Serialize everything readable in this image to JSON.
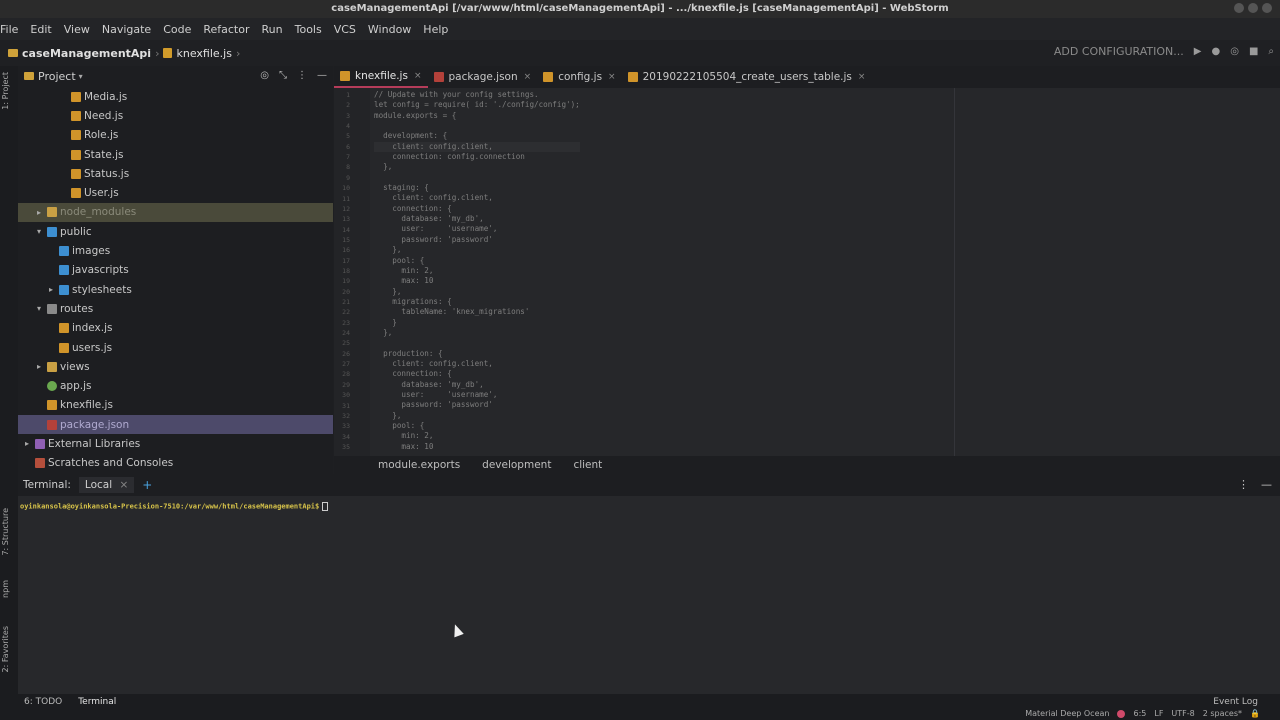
{
  "window": {
    "title": "caseManagementApi [/var/www/html/caseManagementApi] - .../knexfile.js [caseManagementApi] - WebStorm"
  },
  "menu": [
    "File",
    "Edit",
    "View",
    "Navigate",
    "Code",
    "Refactor",
    "Run",
    "Tools",
    "VCS",
    "Window",
    "Help"
  ],
  "nav": {
    "project": "caseManagementApi",
    "file": "knexfile.js",
    "run_config": "ADD CONFIGURATION..."
  },
  "sidebar_stripe": {
    "project": "1: Project",
    "structure": "7: Structure",
    "npm": "npm",
    "favorites": "2: Favorites"
  },
  "project_panel": {
    "title": "Project",
    "tree": [
      {
        "label": "Media.js",
        "indent": 3,
        "icon": "js"
      },
      {
        "label": "Need.js",
        "indent": 3,
        "icon": "js"
      },
      {
        "label": "Role.js",
        "indent": 3,
        "icon": "js"
      },
      {
        "label": "State.js",
        "indent": 3,
        "icon": "js"
      },
      {
        "label": "Status.js",
        "indent": 3,
        "icon": "js"
      },
      {
        "label": "User.js",
        "indent": 3,
        "icon": "js"
      },
      {
        "label": "node_modules",
        "indent": 1,
        "icon": "folder",
        "arrow": "▸"
      },
      {
        "label": "public",
        "indent": 1,
        "icon": "folder-blue",
        "arrow": "▾"
      },
      {
        "label": "images",
        "indent": 2,
        "icon": "folder-blue"
      },
      {
        "label": "javascripts",
        "indent": 2,
        "icon": "folder-blue"
      },
      {
        "label": "stylesheets",
        "indent": 2,
        "icon": "folder-blue",
        "arrow": "▸"
      },
      {
        "label": "routes",
        "indent": 1,
        "icon": "folder-grey",
        "arrow": "▾"
      },
      {
        "label": "index.js",
        "indent": 2,
        "icon": "js"
      },
      {
        "label": "users.js",
        "indent": 2,
        "icon": "js"
      },
      {
        "label": "views",
        "indent": 1,
        "icon": "folder",
        "arrow": "▸"
      },
      {
        "label": "app.js",
        "indent": 1,
        "icon": "app"
      },
      {
        "label": "knexfile.js",
        "indent": 1,
        "icon": "js"
      },
      {
        "label": "package.json",
        "indent": 1,
        "icon": "json"
      },
      {
        "label": "External Libraries",
        "indent": 0,
        "icon": "lib",
        "arrow": "▸"
      },
      {
        "label": "Scratches and Consoles",
        "indent": 0,
        "icon": "scratch"
      }
    ]
  },
  "tabs": [
    {
      "label": "knexfile.js",
      "icon": "js",
      "active": true
    },
    {
      "label": "package.json",
      "icon": "json"
    },
    {
      "label": "config.js",
      "icon": "js"
    },
    {
      "label": "20190222105504_create_users_table.js",
      "icon": "js"
    }
  ],
  "code_lines": [
    "// Update with your config settings.",
    "let config = require( id: './config/config');",
    "module.exports = {",
    "",
    "  development: {",
    "    client: config.client,",
    "    connection: config.connection",
    "  },",
    "",
    "  staging: {",
    "    client: config.client,",
    "    connection: {",
    "      database: 'my_db',",
    "      user:     'username',",
    "      password: 'password'",
    "    },",
    "    pool: {",
    "      min: 2,",
    "      max: 10",
    "    },",
    "    migrations: {",
    "      tableName: 'knex_migrations'",
    "    }",
    "  },",
    "",
    "  production: {",
    "    client: config.client,",
    "    connection: {",
    "      database: 'my_db',",
    "      user:     'username',",
    "      password: 'password'",
    "    },",
    "    pool: {",
    "      min: 2,",
    "      max: 10"
  ],
  "current_line": 6,
  "breadcrumbs": [
    "module.exports",
    "development",
    "client"
  ],
  "terminal": {
    "title": "Terminal:",
    "tab": "Local",
    "prompt": "oyinkansola@oyinkansola-Precision-7510:/var/www/html/caseManagementApi$"
  },
  "bottom_tools": {
    "todo": "6: TODO",
    "terminal": "Terminal",
    "event_log": "Event Log"
  },
  "status": {
    "theme": "Material Deep Ocean",
    "position": "6:5",
    "line_sep": "LF",
    "encoding": "UTF-8",
    "indent": "2 spaces*"
  }
}
